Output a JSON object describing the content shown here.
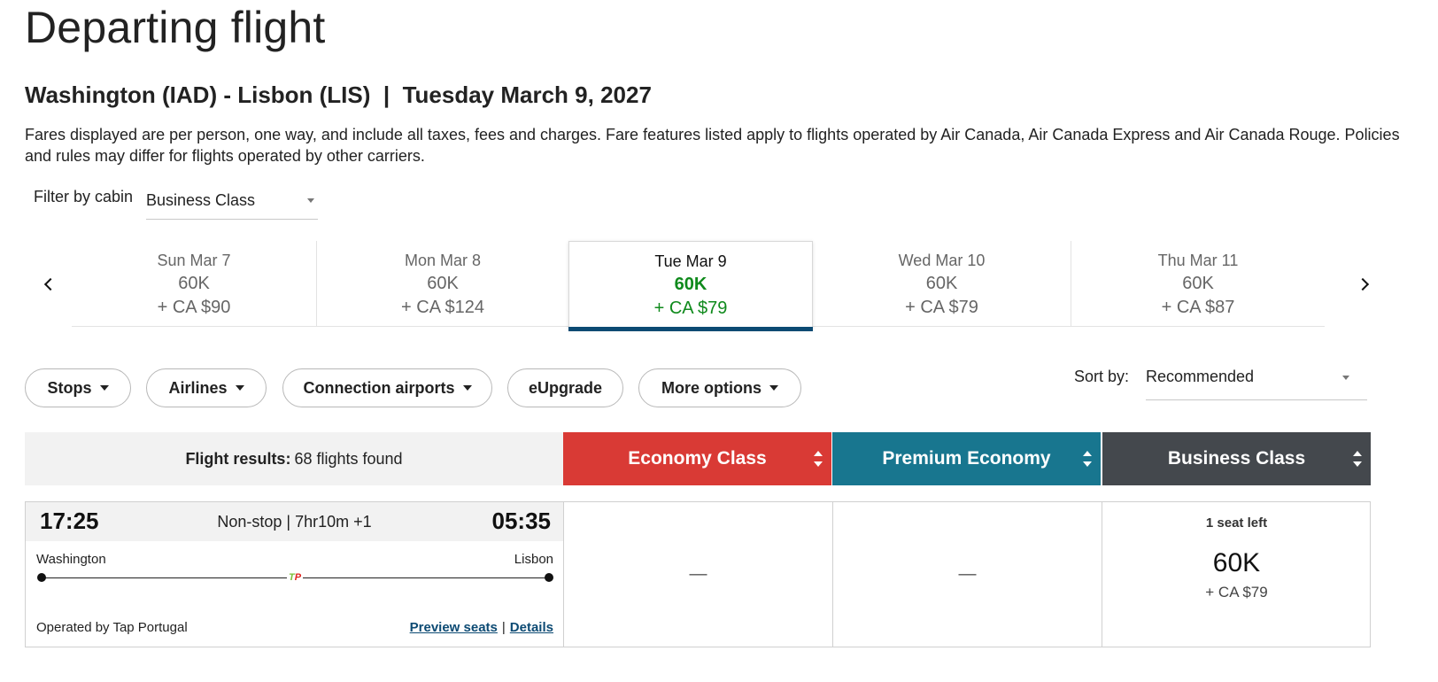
{
  "header": {
    "title": "Departing flight",
    "route": "Washington (IAD) - Lisbon (LIS)  |  Tuesday March 9, 2027",
    "note": "Fares displayed are per person, one way, and include all taxes, fees and charges. Fare features listed apply to flights operated by Air Canada, Air Canada Express and Air Canada Rouge. Policies and rules may differ for flights operated by other carriers."
  },
  "cabin_filter": {
    "label": "Filter by cabin",
    "value": "Business Class"
  },
  "dates": [
    {
      "label": "Sun Mar 7",
      "points": "60K",
      "cash": "+ CA $90",
      "selected": false
    },
    {
      "label": "Mon Mar 8",
      "points": "60K",
      "cash": "+ CA $124",
      "selected": false
    },
    {
      "label": "Tue Mar 9",
      "points": "60K",
      "cash": "+ CA $79",
      "selected": true
    },
    {
      "label": "Wed Mar 10",
      "points": "60K",
      "cash": "+ CA $79",
      "selected": false
    },
    {
      "label": "Thu Mar 11",
      "points": "60K",
      "cash": "+ CA $87",
      "selected": false
    }
  ],
  "filters": {
    "stops": "Stops",
    "airlines": "Airlines",
    "connection_airports": "Connection airports",
    "eupgrade": "eUpgrade",
    "more_options": "More options"
  },
  "sort": {
    "label": "Sort by:",
    "value": "Recommended"
  },
  "results": {
    "label": "Flight results:",
    "count": "68 flights found"
  },
  "cabins": [
    {
      "name": "Economy Class",
      "color": "#d93a35"
    },
    {
      "name": "Premium Economy",
      "color": "#18768f"
    },
    {
      "name": "Business Class",
      "color": "#44484d"
    }
  ],
  "flight": {
    "departure_time": "17:25",
    "arrival_time": "05:35",
    "stops_duration": "Non-stop | 7hr10m +1",
    "origin": "Washington",
    "destination": "Lisbon",
    "airline_logo": "tap-portugal-logo",
    "operated_by": "Operated by Tap Portugal",
    "preview_seats": "Preview seats",
    "details": "Details",
    "economy": "—",
    "premium": "—",
    "business": {
      "seats_left": "1 seat left",
      "points": "60K",
      "cash": "+ CA $79"
    }
  }
}
